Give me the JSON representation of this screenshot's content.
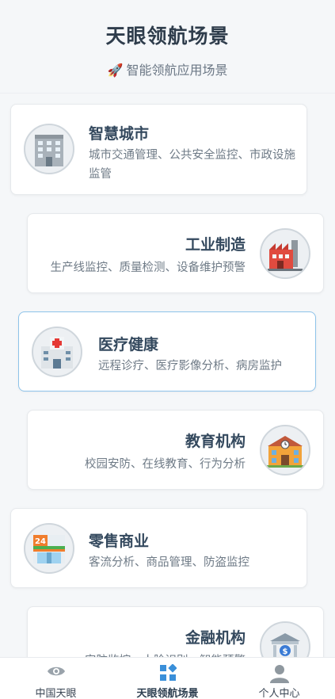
{
  "header": {
    "title": "天眼领航场景",
    "subtitle_icon": "rocket",
    "subtitle": "智能领航应用场景"
  },
  "cards": [
    {
      "title": "智慧城市",
      "desc": "城市交通管理、公共安全监控、市政设施监管",
      "icon": "building-icon",
      "align": "left"
    },
    {
      "title": "工业制造",
      "desc": "生产线监控、质量检测、设备维护预警",
      "icon": "factory-icon",
      "align": "right"
    },
    {
      "title": "医疗健康",
      "desc": "远程诊疗、医疗影像分析、病房监护",
      "icon": "hospital-icon",
      "align": "left",
      "active": true
    },
    {
      "title": "教育机构",
      "desc": "校园安防、在线教育、行为分析",
      "icon": "school-icon",
      "align": "right"
    },
    {
      "title": "零售商业",
      "desc": "客流分析、商品管理、防盗监控",
      "icon": "store-icon",
      "align": "left"
    },
    {
      "title": "金融机构",
      "desc": "安防监控、人脸识别、智能预警",
      "icon": "bank-icon",
      "align": "right"
    }
  ],
  "tabbar": {
    "tabs": [
      {
        "label": "中国天眼",
        "icon": "eye-icon",
        "active": false
      },
      {
        "label": "天眼领航场景",
        "icon": "grid-icon",
        "active": true
      },
      {
        "label": "个人中心",
        "icon": "user-icon",
        "active": false
      }
    ]
  },
  "colors": {
    "accent": "#3a8fd9",
    "active_border": "#8ec3ea",
    "background": "#f5f7f9"
  }
}
